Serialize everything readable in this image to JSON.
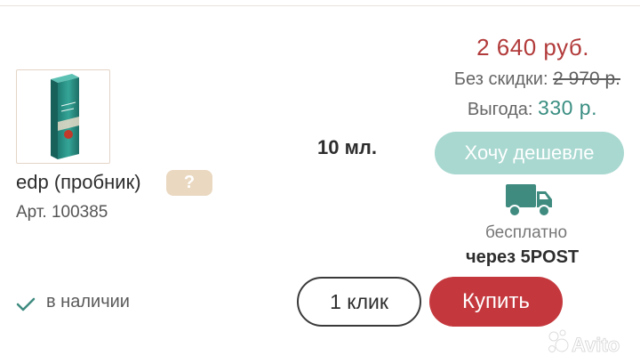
{
  "product": {
    "name": "edp (пробник)",
    "help_badge": "?",
    "sku": "Арт. 100385",
    "volume": "10 мл.",
    "image_icon": "product-box-image"
  },
  "pricing": {
    "price": "2 640 руб.",
    "old_price_label": "Без скидки:",
    "old_price": "2 970 р.",
    "savings_label": "Выгода:",
    "savings_value": "330 р."
  },
  "actions": {
    "cheaper_label": "Хочу дешевле",
    "one_click_label": "1 клик",
    "buy_label": "Купить"
  },
  "delivery": {
    "icon": "truck-icon",
    "free_text": "бесплатно",
    "via_text": "через 5POST"
  },
  "stock": {
    "icon": "check-icon",
    "label": "в наличии"
  },
  "watermark": {
    "text": "Avito"
  },
  "colors": {
    "price_red": "#b23a3a",
    "buy_button": "#c4383d",
    "savings_teal": "#3a8e82",
    "cheaper_button": "#a8d8d0",
    "help_badge": "#ead8c0"
  }
}
